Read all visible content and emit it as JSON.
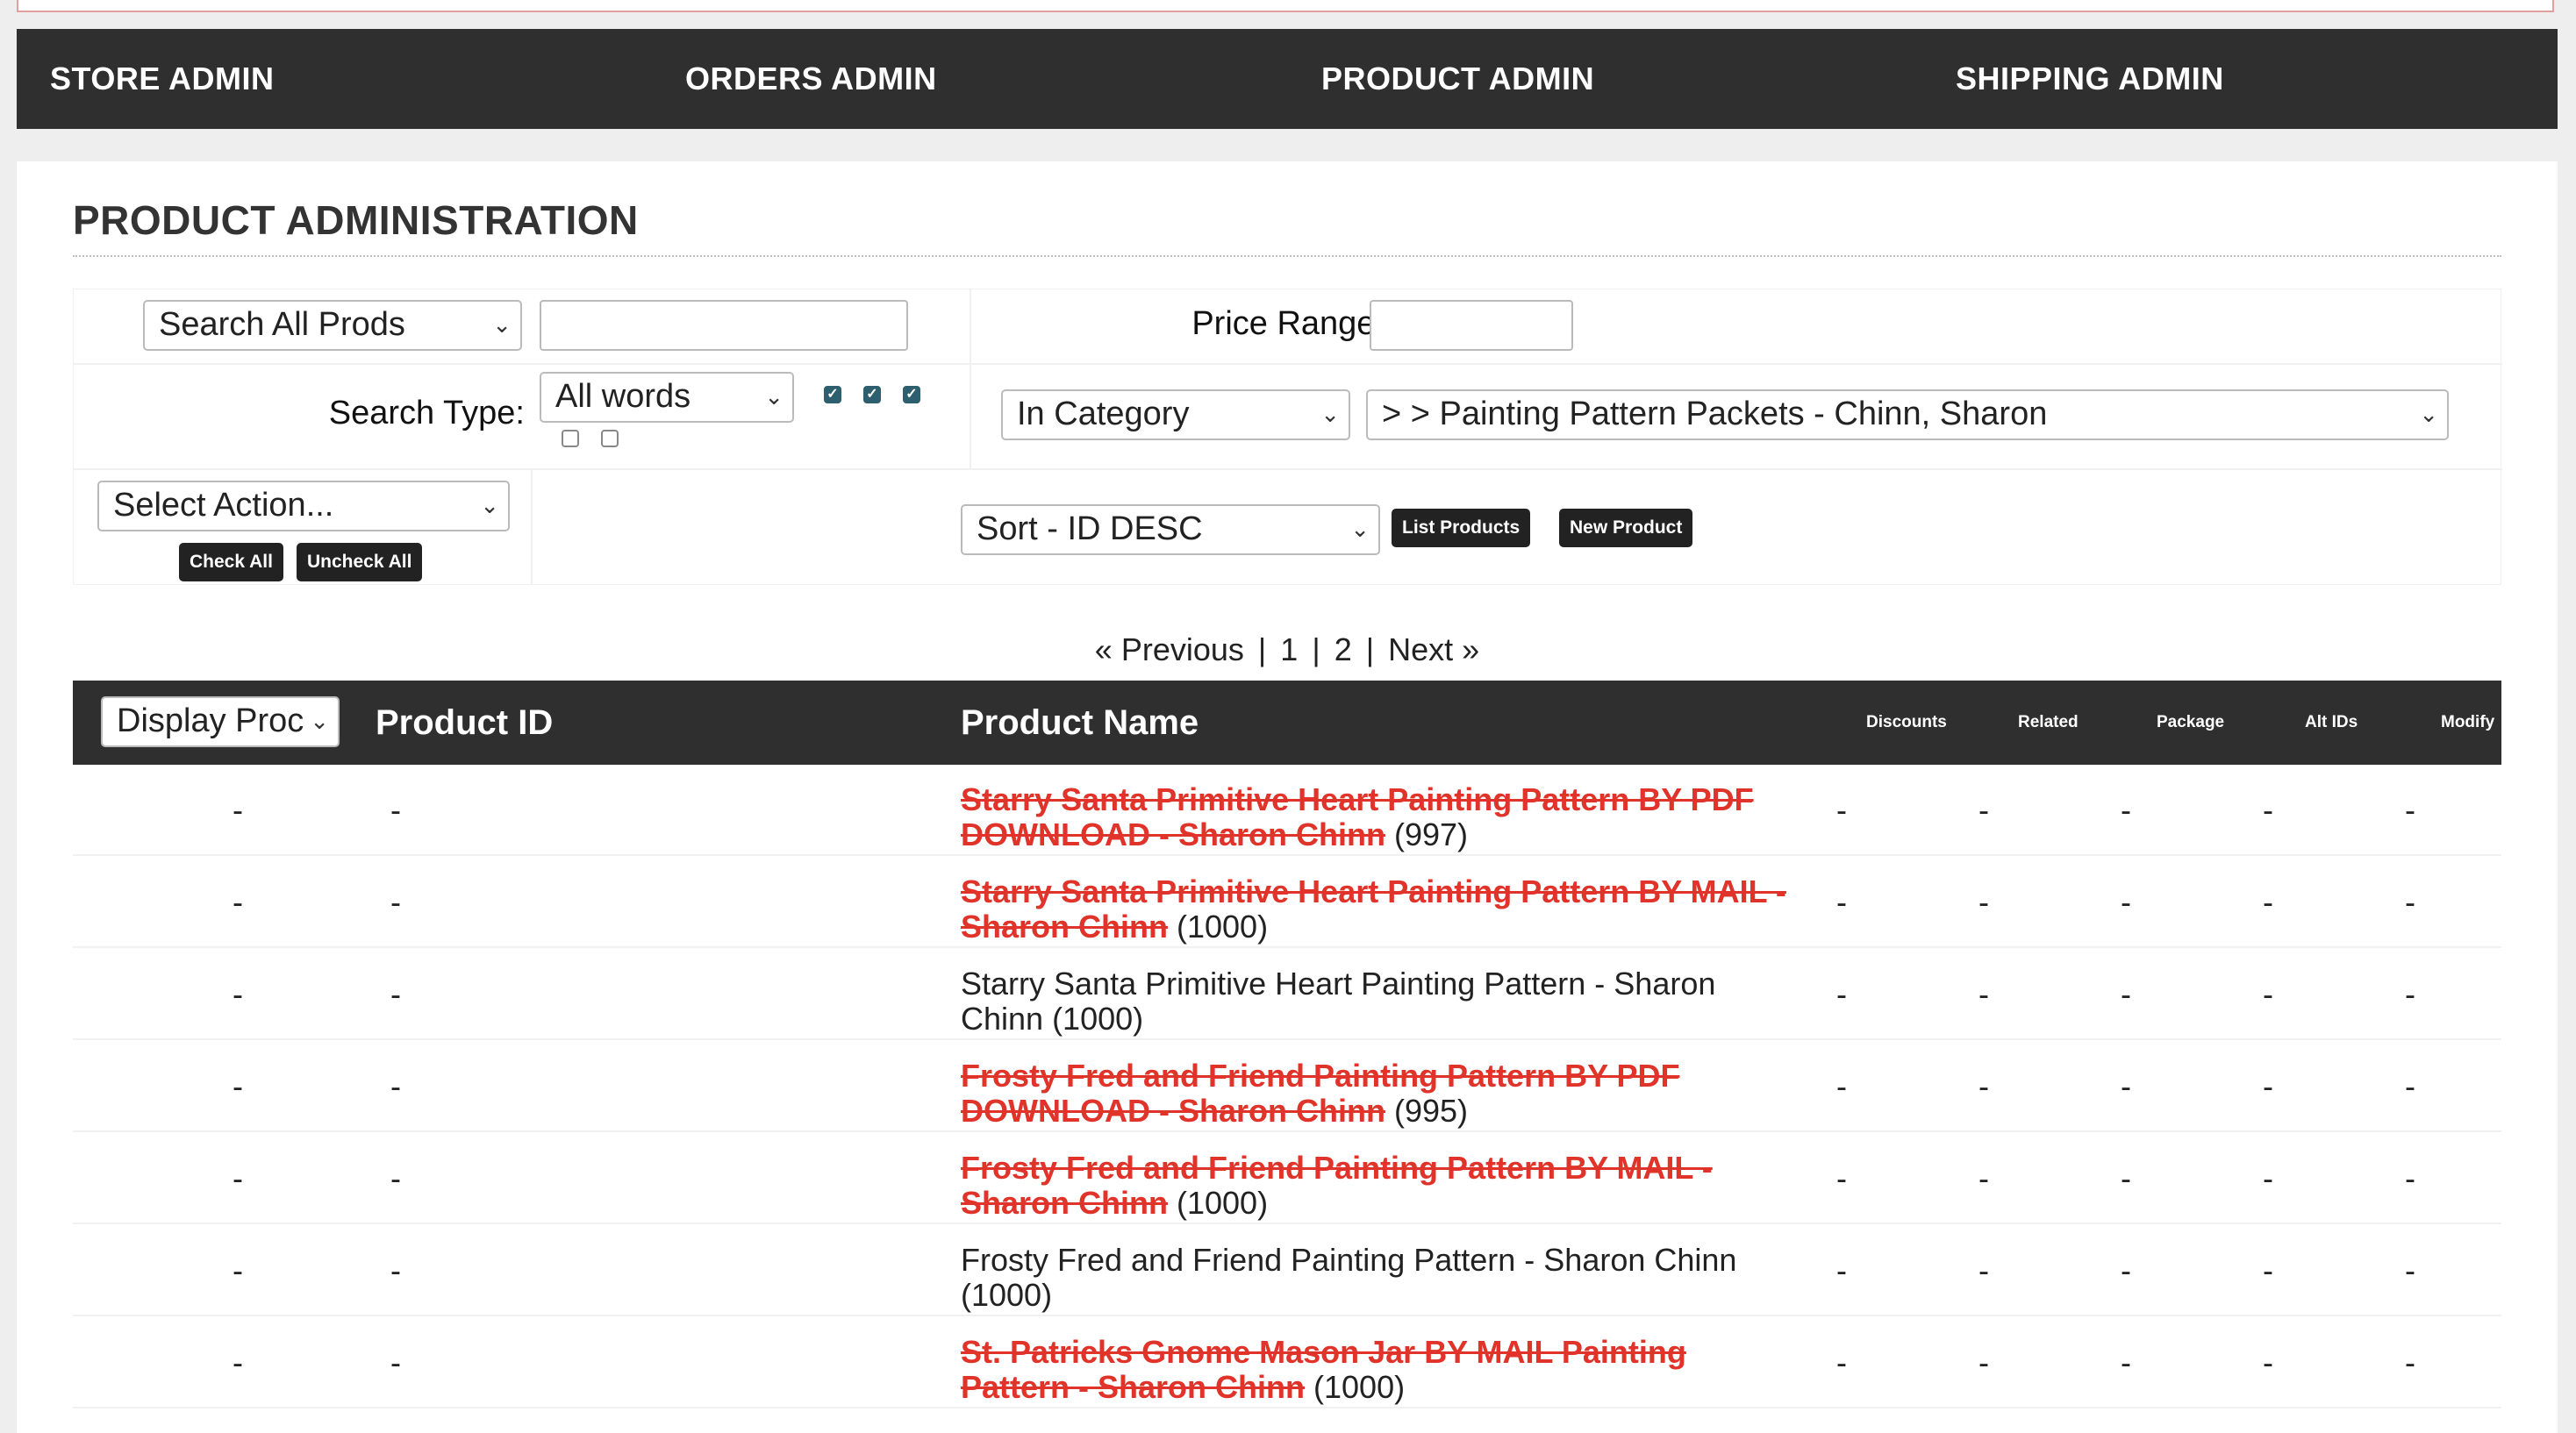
{
  "nav": [
    {
      "label": "STORE ADMIN"
    },
    {
      "label": "ORDERS ADMIN"
    },
    {
      "label": "PRODUCT ADMIN"
    },
    {
      "label": "SHIPPING ADMIN"
    }
  ],
  "page_title": "PRODUCT ADMINISTRATION",
  "filters": {
    "search_scope": "Search All Prods",
    "search_value": "",
    "price_range_label": "Price Range:",
    "price_range_value": "",
    "search_type_label": "Search Type:",
    "search_type": "All words",
    "category_mode": "In Category",
    "category": "> > Painting Pattern Packets - Chinn, Sharon",
    "action": "Select Action...",
    "sort": "Sort - ID DESC"
  },
  "buttons": {
    "check_all": "Check All",
    "uncheck_all": "Uncheck All",
    "list_products": "List Products",
    "new_product": "New Product"
  },
  "pagination": {
    "prev_icon": "«",
    "prev": "Previous",
    "sep": "|",
    "page1": "1",
    "page2": "2",
    "next": "Next",
    "next_icon": "»"
  },
  "table": {
    "display_select": "Display Proc",
    "headers": {
      "product_id": "Product ID",
      "product_name": "Product Name",
      "discounts": "Discounts",
      "related": "Related",
      "package": "Package",
      "alt_ids": "Alt IDs",
      "modify": "Modify"
    },
    "dash": "-",
    "rows": [
      {
        "name": "Starry Santa Primitive Heart Painting Pattern BY PDF DOWNLOAD - Sharon Chinn",
        "qty": " (997)",
        "inactive": true
      },
      {
        "name": "Starry Santa Primitive Heart Painting Pattern BY MAIL - Sharon Chinn",
        "qty": " (1000)",
        "inactive": true
      },
      {
        "name": "Starry Santa Primitive Heart Painting Pattern - Sharon Chinn",
        "qty": " (1000)",
        "inactive": false
      },
      {
        "name": "Frosty Fred and Friend Painting Pattern BY PDF DOWNLOAD - Sharon Chinn",
        "qty": " (995)",
        "inactive": true
      },
      {
        "name": "Frosty Fred and Friend Painting Pattern BY MAIL - Sharon Chinn",
        "qty": " (1000)",
        "inactive": true
      },
      {
        "name": "Frosty Fred and Friend Painting Pattern - Sharon Chinn",
        "qty": " (1000)",
        "inactive": false
      },
      {
        "name": "St. Patricks Gnome Mason Jar BY MAIL Painting Pattern - Sharon Chinn",
        "qty": " (1000)",
        "inactive": true
      }
    ]
  }
}
